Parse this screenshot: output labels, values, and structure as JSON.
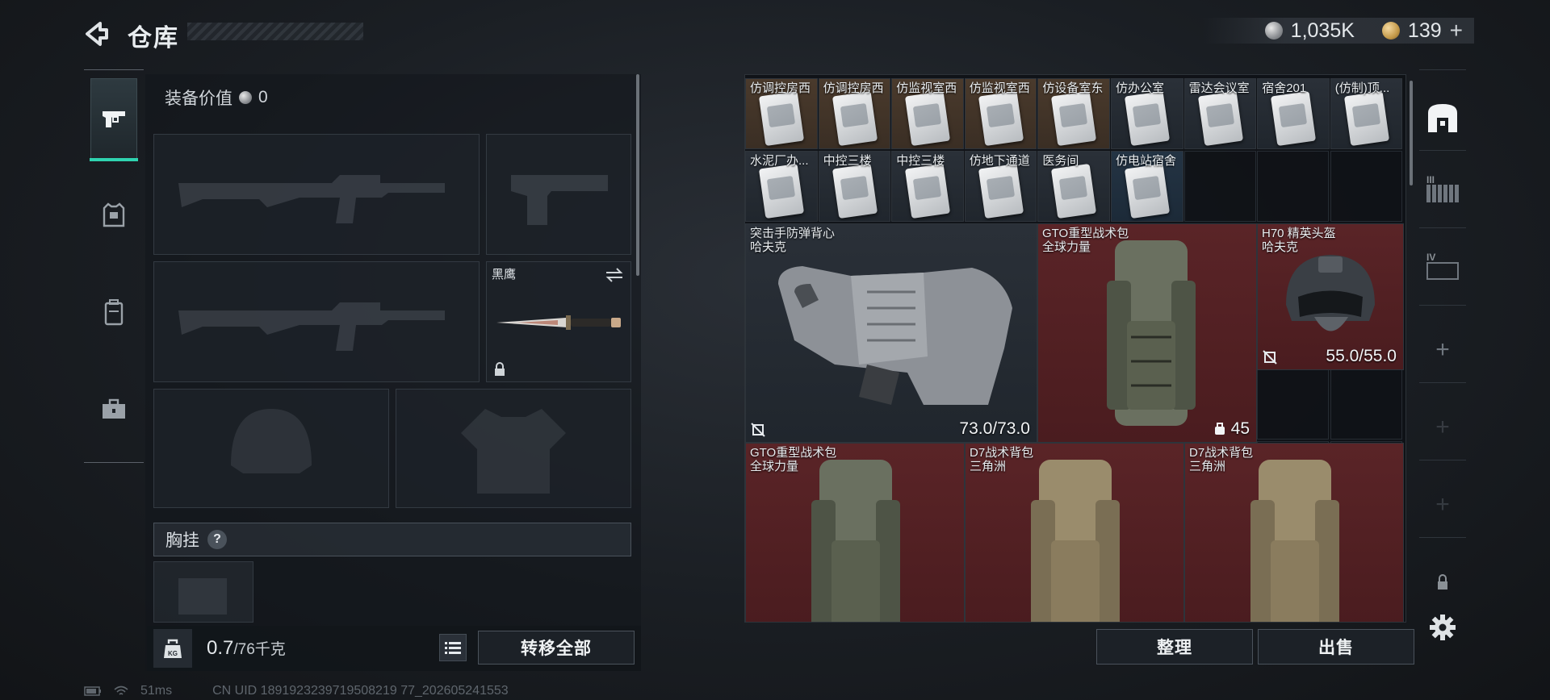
{
  "header": {
    "title": "仓库",
    "currency": [
      {
        "icon": "silver-coin-icon",
        "value": "1,035K"
      },
      {
        "icon": "gold-coin-icon",
        "value": "139"
      }
    ],
    "add_label": "+"
  },
  "side_tabs": [
    {
      "name": "weapon-tab",
      "icon": "pistol-icon",
      "active": true
    },
    {
      "name": "armor-tab",
      "icon": "armor-icon",
      "active": false
    },
    {
      "name": "backpack-tab",
      "icon": "backpack-icon",
      "active": false
    },
    {
      "name": "toolbox-tab",
      "icon": "toolbox-icon",
      "active": false
    }
  ],
  "loadout": {
    "equip_value_label": "装备价值",
    "equip_value": "0",
    "knife_name": "黑鹰",
    "chest_rig_label": "胸挂",
    "help": "?",
    "weight_value": "0.7",
    "weight_unit": "/76千克",
    "kg_label": "KG",
    "transfer_all": "转移全部"
  },
  "stash": {
    "keys_row1": [
      {
        "name": "仿调控房西",
        "bg": "brown"
      },
      {
        "name": "仿调控房西",
        "bg": "brown"
      },
      {
        "name": "仿监视室西",
        "bg": "brown"
      },
      {
        "name": "仿监视室西",
        "bg": "brown"
      },
      {
        "name": "仿设备室东",
        "bg": "brown"
      },
      {
        "name": "仿办公室",
        "bg": "grey"
      },
      {
        "name": "雷达会议室",
        "bg": "grey"
      },
      {
        "name": "宿舍201",
        "bg": "grey"
      },
      {
        "name": "(仿制)顶...",
        "bg": "grey"
      }
    ],
    "keys_row2": [
      {
        "name": "水泥厂办...",
        "bg": "grey"
      },
      {
        "name": "中控三楼",
        "bg": "grey"
      },
      {
        "name": "中控三楼",
        "bg": "grey"
      },
      {
        "name": "仿地下通道",
        "bg": "grey"
      },
      {
        "name": "医务间",
        "bg": "grey"
      },
      {
        "name": "仿电站宿舍",
        "bg": "blue"
      }
    ],
    "vest": {
      "name": "突击手防弹背心",
      "brand": "哈夫克",
      "durability": "73.0/73.0"
    },
    "gto_pack_1": {
      "name": "GTO重型战术包",
      "brand": "全球力量",
      "count": "45"
    },
    "helmet": {
      "name": "H70 精英头盔",
      "brand": "哈夫克",
      "durability": "55.0/55.0"
    },
    "gto_pack_2": {
      "name": "GTO重型战术包",
      "brand": "全球力量"
    },
    "d7_pack_1": {
      "name": "D7战术背包",
      "brand": "三角洲"
    },
    "d7_pack_2": {
      "name": "D7战术背包",
      "brand": "三角洲"
    },
    "sort_button": "整理",
    "sell_button": "出售"
  },
  "right_column": {
    "plus": "+",
    "roman_3": "III",
    "roman_4": "IV"
  },
  "footer": {
    "ping": "51ms",
    "uid": "CN UID 1891923239719508219 77_202605241553"
  },
  "colors": {
    "accent": "#2fd3b0",
    "rare_red": "#5a2427",
    "key_brown": "#4a3a2c"
  }
}
